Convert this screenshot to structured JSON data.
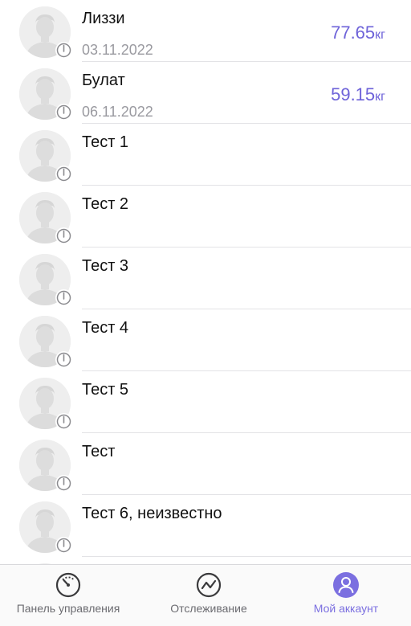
{
  "contacts": [
    {
      "name": "Лиззи",
      "date": "03.11.2022",
      "weight": "77.65",
      "unit": "кг"
    },
    {
      "name": "Булат",
      "date": "06.11.2022",
      "weight": "59.15",
      "unit": "кг"
    },
    {
      "name": "Тест 1"
    },
    {
      "name": "Тест 2"
    },
    {
      "name": "Тест 3"
    },
    {
      "name": "Тест 4"
    },
    {
      "name": "Тест 5"
    },
    {
      "name": "Тест"
    },
    {
      "name": "Тест 6, неизвестно"
    },
    {
      "name": ""
    }
  ],
  "tabbar": {
    "tabs": [
      {
        "label": "Панель управления",
        "icon": "dashboard-gauge-icon"
      },
      {
        "label": "Отслеживание",
        "icon": "tracking-chart-icon"
      },
      {
        "label": "Мой аккаунт",
        "icon": "account-icon",
        "active": true
      }
    ]
  },
  "colors": {
    "accent": "#7b6fe0",
    "weight_text": "#6e63d9",
    "secondary_text": "#9a9aa0"
  }
}
